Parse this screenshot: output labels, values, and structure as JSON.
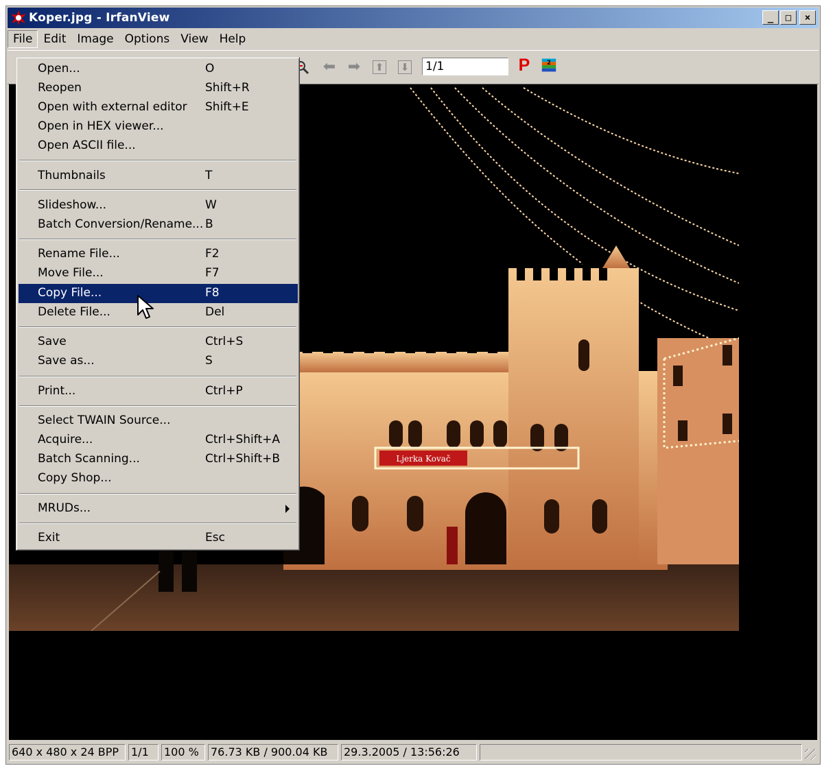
{
  "window": {
    "title": "Koper.jpg - IrfanView",
    "controls": {
      "minimize": "_",
      "maximize": "□",
      "close": "×"
    }
  },
  "menubar": [
    "File",
    "Edit",
    "Image",
    "Options",
    "View",
    "Help"
  ],
  "toolbar": {
    "page_value": "1/1",
    "p_label": "P"
  },
  "file_menu": {
    "items": [
      {
        "label": "Open...",
        "shortcut": "O"
      },
      {
        "label": "Reopen",
        "shortcut": "Shift+R"
      },
      {
        "label": "Open with external editor",
        "shortcut": "Shift+E"
      },
      {
        "label": "Open in HEX viewer...",
        "shortcut": ""
      },
      {
        "label": "Open ASCII file...",
        "shortcut": ""
      },
      {
        "label": "Thumbnails",
        "shortcut": "T"
      },
      {
        "label": "Slideshow...",
        "shortcut": "W"
      },
      {
        "label": "Batch Conversion/Rename...",
        "shortcut": "B"
      },
      {
        "label": "Rename File...",
        "shortcut": "F2"
      },
      {
        "label": "Move File...",
        "shortcut": "F7"
      },
      {
        "label": "Copy File...",
        "shortcut": "F8"
      },
      {
        "label": "Delete File...",
        "shortcut": "Del"
      },
      {
        "label": "Save",
        "shortcut": "Ctrl+S"
      },
      {
        "label": "Save as...",
        "shortcut": "S"
      },
      {
        "label": "Print...",
        "shortcut": "Ctrl+P"
      },
      {
        "label": "Select TWAIN Source...",
        "shortcut": ""
      },
      {
        "label": "Acquire...",
        "shortcut": "Ctrl+Shift+A"
      },
      {
        "label": "Batch Scanning...",
        "shortcut": "Ctrl+Shift+B"
      },
      {
        "label": "Copy Shop...",
        "shortcut": ""
      },
      {
        "label": "MRUDs...",
        "shortcut": ""
      },
      {
        "label": "Exit",
        "shortcut": "Esc"
      }
    ]
  },
  "image": {
    "banner_text": "Ljerka Kovač"
  },
  "statusbar": {
    "dims": "640 x 480 x 24 BPP",
    "page": "1/1",
    "zoom": "100 %",
    "size": "76.73 KB / 900.04 KB",
    "date": "29.3.2005 / 13:56:26"
  },
  "colors": {
    "highlight": "#0a246a",
    "titlebar": "#0a246a",
    "face": "#d4d0c8"
  }
}
